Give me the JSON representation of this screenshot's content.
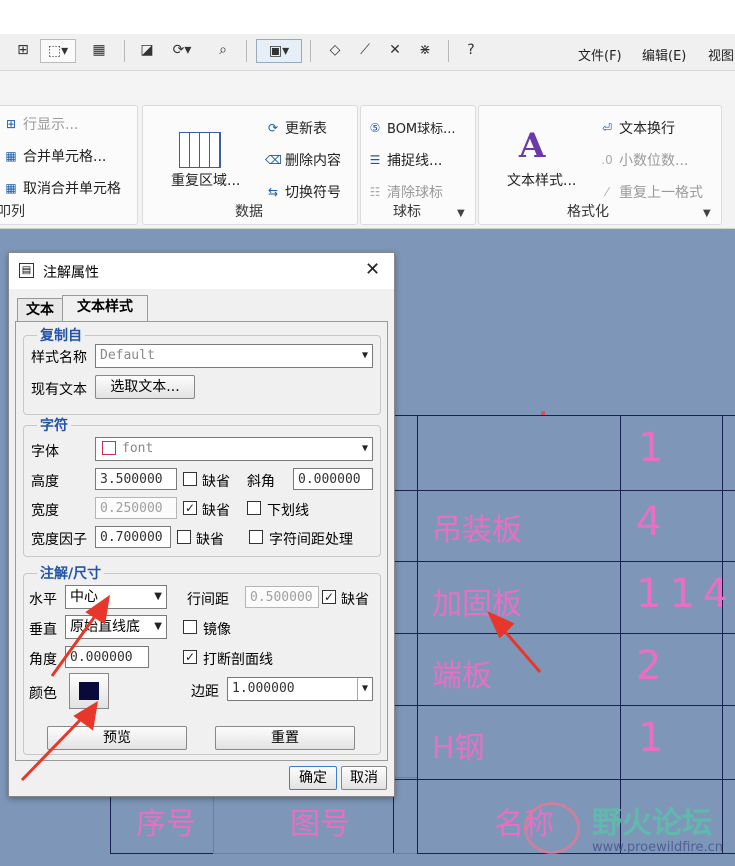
{
  "menu": {
    "file": "文件(F)",
    "edit": "编辑(E)",
    "view": "视图"
  },
  "ribbon": {
    "table_group": {
      "items": [
        "行显示...",
        "合并单元格...",
        "取消合并单元格"
      ],
      "label": "叩列"
    },
    "data_group": {
      "big": "重复区域...",
      "items": [
        "更新表",
        "删除内容",
        "切换符号"
      ],
      "label": "数据"
    },
    "balloon_group": {
      "items": [
        "BOM球标...",
        "捕捉线...",
        "清除球标"
      ],
      "label": "球标"
    },
    "format_group": {
      "big": "文本样式...",
      "items": [
        "文本换行",
        "小数位数...",
        "重复上一格式"
      ],
      "label": "格式化"
    }
  },
  "drawing": {
    "rows": [
      "吊装板",
      "加固板",
      "端板",
      "H钢"
    ],
    "nums": [
      "1",
      "4",
      "114",
      "2",
      "1"
    ],
    "header": [
      "序号",
      "图号",
      "名称"
    ]
  },
  "dialog": {
    "title": "注解属性",
    "tabs": [
      "文本",
      "文本样式"
    ],
    "copy_from": {
      "title": "复制自",
      "style_label": "样式名称",
      "style_value": "Default",
      "existing_label": "现有文本",
      "select_button": "选取文本..."
    },
    "char": {
      "title": "字符",
      "font_label": "字体",
      "font_value": "font",
      "height_label": "高度",
      "height_value": "3.500000",
      "default_label": "缺省",
      "slant_label": "斜角",
      "slant_value": "0.000000",
      "width_label": "宽度",
      "width_value": "0.250000",
      "underline_label": "下划线",
      "wfactor_label": "宽度因子",
      "wfactor_value": "0.700000",
      "kerning_label": "字符间距处理"
    },
    "note": {
      "title": "注解/尺寸",
      "h_label": "水平",
      "h_value": "中心",
      "linespace_label": "行间距",
      "linespace_value": "0.500000",
      "default_label": "缺省",
      "v_label": "垂直",
      "v_value": "原始直线底",
      "mirror_label": "镜像",
      "angle_label": "角度",
      "angle_value": "0.000000",
      "break_label": "打断剖面线",
      "color_label": "颜色",
      "margin_label": "边距",
      "margin_value": "1.000000",
      "preview_button": "预览",
      "reset_button": "重置"
    },
    "ok_button": "确定",
    "cancel_button": "取消"
  },
  "watermark": {
    "name": "野火论坛",
    "url": "www.proewildfire.cn"
  },
  "colors": {
    "canvas": "#7e97b9",
    "pink": "#e86fc4",
    "accent": "#2354a8",
    "arrow": "#e8372a",
    "swatch": "#0a0a3a"
  }
}
